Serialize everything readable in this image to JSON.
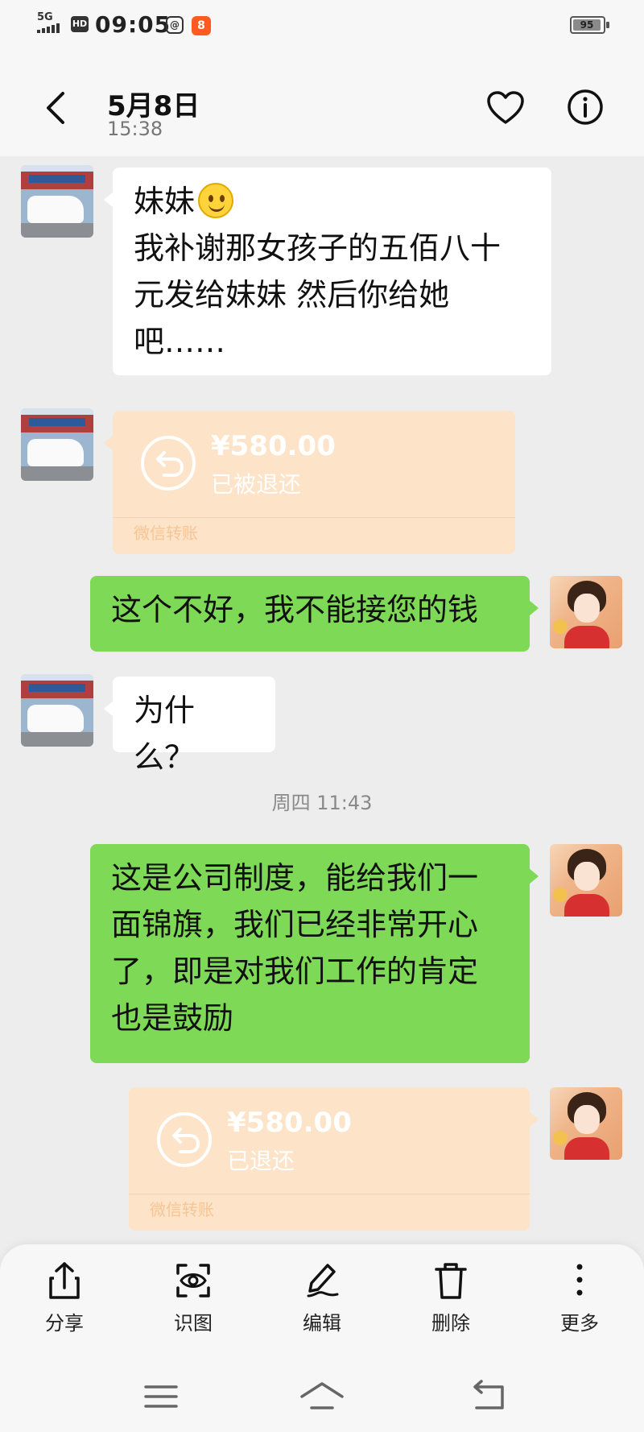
{
  "status_bar": {
    "network": "5G",
    "hd": "HD",
    "time": "09:05",
    "battery": "95"
  },
  "header": {
    "title": "5月8日",
    "subtitle": "15:38"
  },
  "messages": {
    "m1": {
      "line1": "妹妹",
      "line2": "我补谢那女孩子的五佰八十",
      "line3": "元发给妹妹  然后你给她",
      "line4": "吧……"
    },
    "t1": {
      "amount": "¥580.00",
      "status": "已被退还",
      "brand": "微信转账"
    },
    "m2": {
      "text": "这个不好，我不能接您的钱"
    },
    "m3": {
      "text": "为什么？"
    },
    "time_divider": "周四 11:43",
    "m4": {
      "line1": "这是公司制度，能给我们一",
      "line2": "面锦旗，我们已经非常开心",
      "line3": "了，即是对我们工作的肯定",
      "line4": "也是鼓励"
    },
    "t2": {
      "amount": "¥580.00",
      "status": "已退还",
      "brand": "微信转账"
    }
  },
  "actions": {
    "share": "分享",
    "recognize": "识图",
    "edit": "编辑",
    "delete": "删除",
    "more": "更多"
  },
  "icons": [
    "back-icon",
    "heart-icon",
    "info-icon",
    "transfer-return-icon",
    "share-icon",
    "scan-image-icon",
    "edit-pen-icon",
    "trash-icon",
    "more-dots-icon",
    "menu-icon",
    "home-icon",
    "back-nav-icon",
    "smiley-emoji-icon"
  ],
  "colors": {
    "sent_bubble": "#7ed957",
    "received_bubble": "#ffffff",
    "transfer_bg": "#fde3c7",
    "chat_bg": "#ededed"
  }
}
